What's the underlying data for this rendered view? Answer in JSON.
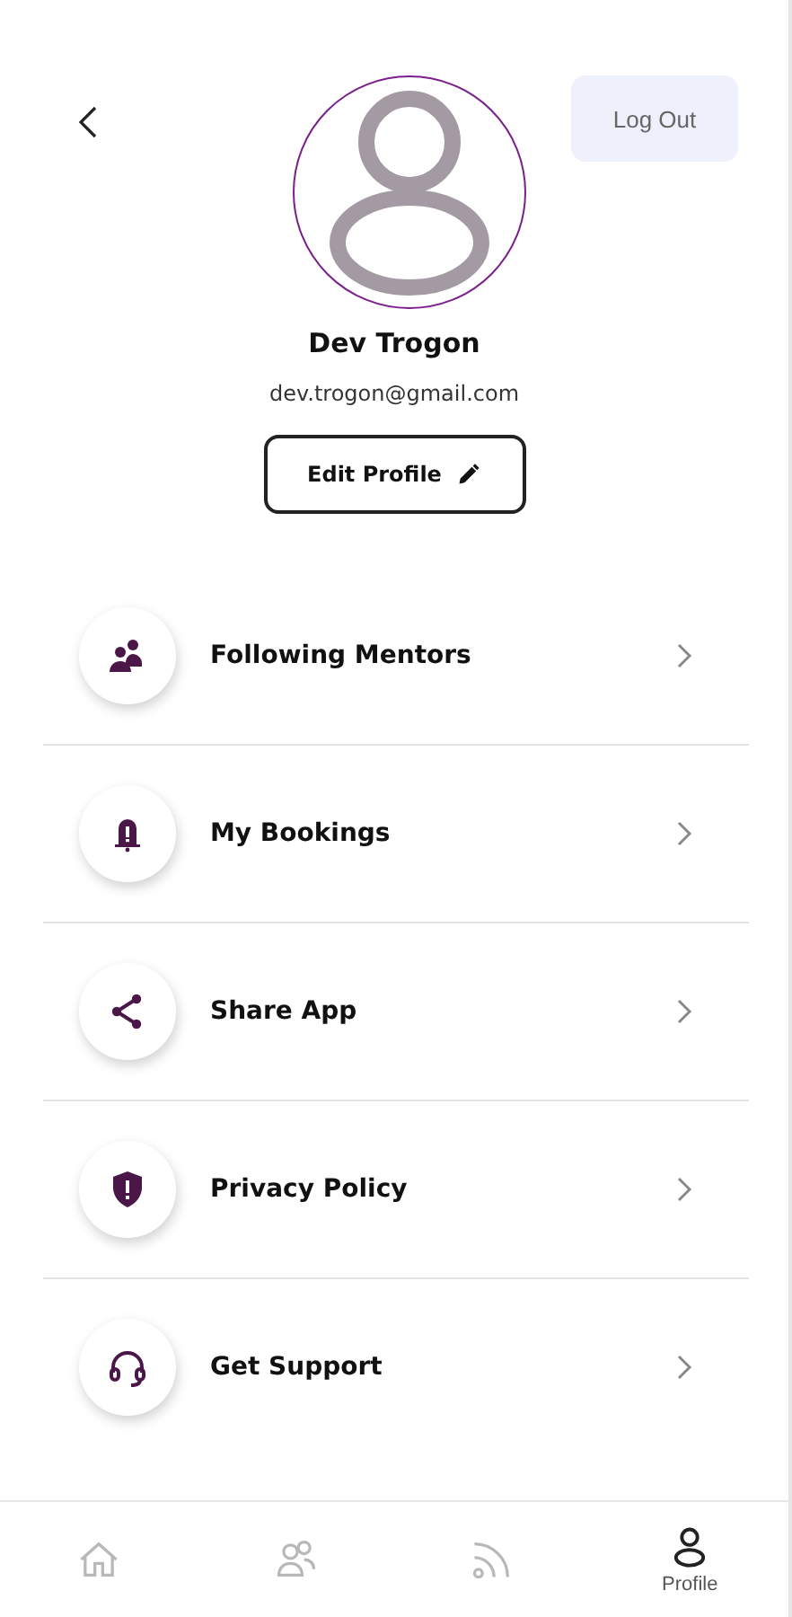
{
  "header": {
    "logout_button": "Log Out"
  },
  "profile": {
    "name": "Dev Trogon",
    "email": "dev.trogon@gmail.com",
    "edit_button": "Edit Profile"
  },
  "menu": [
    {
      "kind": "mentors",
      "label": "Following Mentors"
    },
    {
      "kind": "bookings",
      "label": "My Bookings"
    },
    {
      "kind": "share",
      "label": "Share App"
    },
    {
      "kind": "privacy",
      "label": "Privacy Policy"
    },
    {
      "kind": "support",
      "label": "Get Support"
    }
  ],
  "bottom_nav": [
    {
      "kind": "home",
      "selected": false
    },
    {
      "kind": "people",
      "selected": false
    },
    {
      "kind": "feed",
      "selected": false
    },
    {
      "kind": "profile",
      "label": "Profile",
      "selected": true
    }
  ]
}
